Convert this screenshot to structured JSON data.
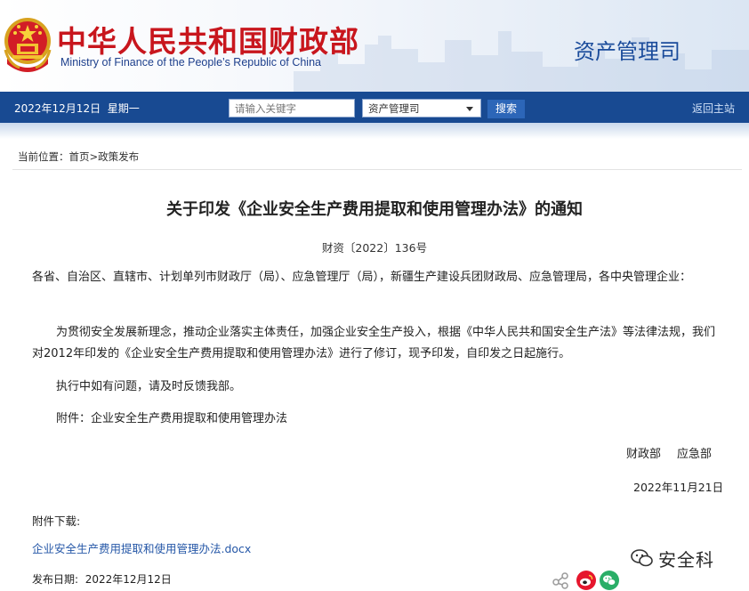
{
  "header": {
    "site_title_cn": "中华人民共和国财政部",
    "site_title_en": "Ministry of Finance of the People’s Republic of China",
    "department": "资产管理司"
  },
  "navbar": {
    "date": "2022年12月12日",
    "weekday": "星期一",
    "search_placeholder": "请输入关键字",
    "dept_select_value": "资产管理司",
    "search_button": "搜索",
    "home_link": "返回主站"
  },
  "breadcrumb": {
    "prefix": "当前位置：",
    "home": "首页",
    "separator": ">",
    "section": "政策发布"
  },
  "article": {
    "title": "关于印发《企业安全生产费用提取和使用管理办法》的通知",
    "doc_number": "财资〔2022〕136号",
    "salutation": "各省、自治区、直辖市、计划单列市财政厅（局）、应急管理厅（局），新疆生产建设兵团财政局、应急管理局，各中央管理企业：",
    "body1": "为贯彻安全发展新理念，推动企业落实主体责任，加强企业安全生产投入，根据《中华人民共和国安全生产法》等法律法规，我们对2012年印发的《企业安全生产费用提取和使用管理办法》进行了修订，现予印发，自印发之日起施行。",
    "body2": "执行中如有问题，请及时反馈我部。",
    "attachment": "附件：企业安全生产费用提取和使用管理办法",
    "signer1": "财政部",
    "signer2": "应急部",
    "sign_date": "2022年11月21日"
  },
  "download": {
    "label": "附件下载:",
    "file_link": "企业安全生产费用提取和使用管理办法.docx"
  },
  "publish": {
    "label": "发布日期:",
    "date": "2022年12月12日"
  },
  "watermark": {
    "text": "安全科"
  },
  "icons": {
    "emblem": "national-emblem-icon",
    "share_link": "share-link-icon",
    "weibo": "weibo-icon",
    "wechat": "wechat-icon",
    "watermark": "wechat-official-account-icon"
  },
  "colors": {
    "nav_blue": "#184a92",
    "title_red": "#c8161d",
    "link_blue": "#2557a7",
    "weibo_red": "#e6162d",
    "wechat_green": "#2aae67"
  }
}
